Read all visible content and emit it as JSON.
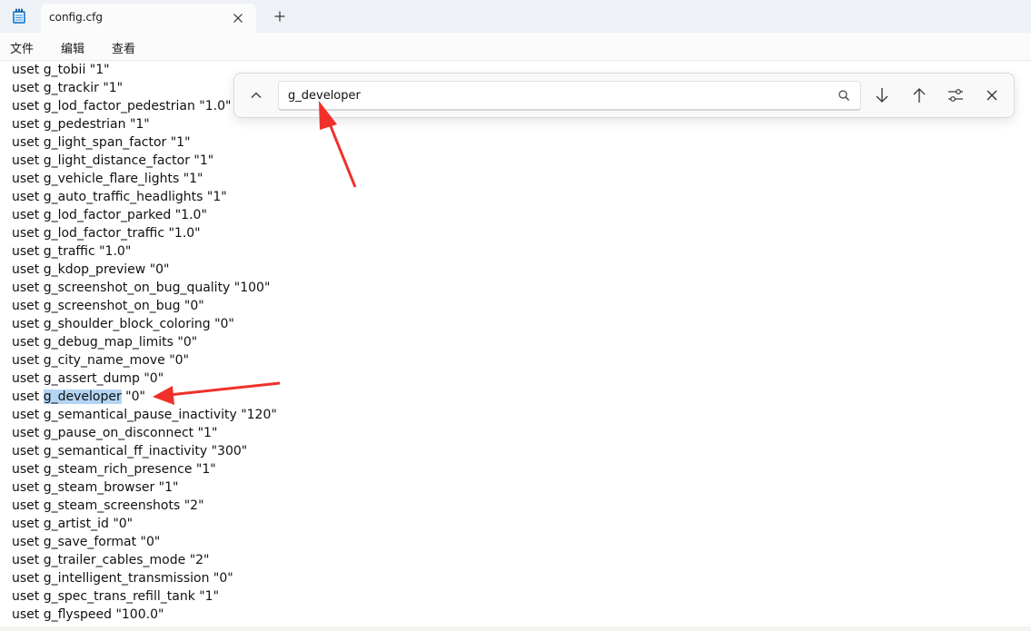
{
  "window": {
    "tab_title": "config.cfg",
    "icons": {
      "app": "notepad-icon",
      "close": "close-icon",
      "new_tab": "plus-icon"
    }
  },
  "menu": {
    "file": "文件",
    "edit": "编辑",
    "view": "查看"
  },
  "find": {
    "query": "g_developer",
    "icons": [
      "chevron-up-icon",
      "search-icon",
      "arrow-down-icon",
      "arrow-up-icon",
      "options-icon",
      "close-icon"
    ]
  },
  "editor": {
    "lines": [
      "uset g_tobii \"1\"",
      "uset g_trackir \"1\"",
      "uset g_lod_factor_pedestrian \"1.0\"",
      "uset g_pedestrian \"1\"",
      "uset g_light_span_factor \"1\"",
      "uset g_light_distance_factor \"1\"",
      "uset g_vehicle_flare_lights \"1\"",
      "uset g_auto_traffic_headlights \"1\"",
      "uset g_lod_factor_parked \"1.0\"",
      "uset g_lod_factor_traffic \"1.0\"",
      "uset g_traffic \"1.0\"",
      "uset g_kdop_preview \"0\"",
      "uset g_screenshot_on_bug_quality \"100\"",
      "uset g_screenshot_on_bug \"0\"",
      "uset g_shoulder_block_coloring \"0\"",
      "uset g_debug_map_limits \"0\"",
      "uset g_city_name_move \"0\"",
      "uset g_assert_dump \"0\"",
      "uset g_developer \"0\"",
      "uset g_semantical_pause_inactivity \"120\"",
      "uset g_pause_on_disconnect \"1\"",
      "uset g_semantical_ff_inactivity \"300\"",
      "uset g_steam_rich_presence \"1\"",
      "uset g_steam_browser \"1\"",
      "uset g_steam_screenshots \"2\"",
      "uset g_artist_id \"0\"",
      "uset g_save_format \"0\"",
      "uset g_trailer_cables_mode \"2\"",
      "uset g_intelligent_transmission \"0\"",
      "uset g_spec_trans_refill_tank \"1\"",
      "uset g_flyspeed \"100.0\""
    ],
    "match": {
      "line_index": 18,
      "prefix": "uset ",
      "text": "g_developer",
      "suffix": " \"0\""
    }
  },
  "colors": {
    "titlebar": "#eef1f6",
    "selection": "#b3d4f3",
    "annotation_arrow": "#f0302a"
  }
}
